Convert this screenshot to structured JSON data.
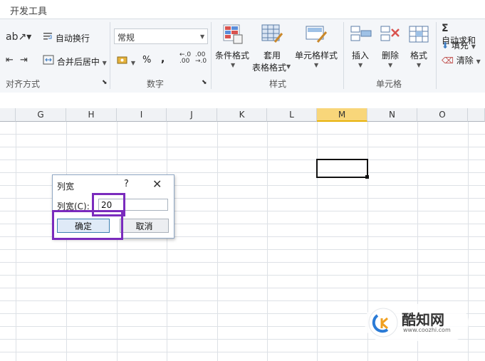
{
  "app": {
    "active_tab": "开发工具"
  },
  "ribbon": {
    "alignment": {
      "wrap_text": "自动换行",
      "merge_center": "合并后居中",
      "group_label": "对齐方式"
    },
    "number": {
      "format_value": "常规",
      "percent": "%",
      "comma": ",",
      "increase_decimal": "←.0 .00",
      "decrease_decimal": ".00 →.0",
      "group_label": "数字"
    },
    "styles": {
      "conditional_format": "条件格式",
      "format_table_line1": "套用",
      "format_table_line2": "表格格式",
      "cell_styles": "单元格样式",
      "group_label": "样式"
    },
    "cells": {
      "insert": "插入",
      "delete": "删除",
      "format": "格式",
      "group_label": "单元格"
    },
    "editing": {
      "autosum": "自动求和",
      "fill": "填充",
      "clear": "清除"
    }
  },
  "sheet": {
    "columns": [
      "G",
      "H",
      "I",
      "J",
      "K",
      "L",
      "M",
      "N",
      "O"
    ],
    "selected_column": "M"
  },
  "dialog": {
    "title": "列宽",
    "help": "?",
    "close": "✕",
    "field_label": "列宽(C):",
    "field_value": "20",
    "ok_label": "确定",
    "cancel_label": "取消"
  },
  "watermark": {
    "brand": "酷知网",
    "url": "www.coozhi.com"
  },
  "colors": {
    "highlight": "#7a2bbd",
    "selected_column": "#f8d67a",
    "ok_border": "#3c7fb1"
  }
}
